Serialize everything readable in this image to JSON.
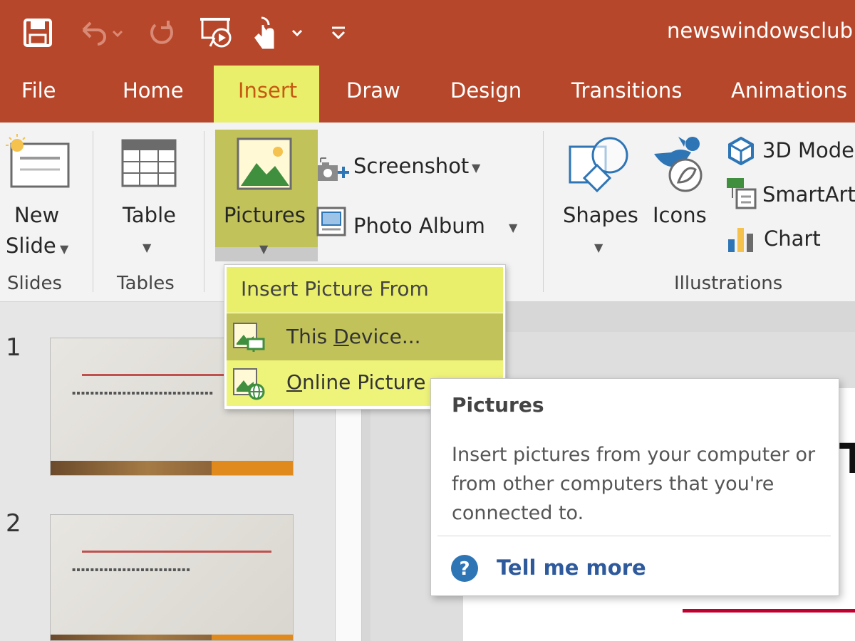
{
  "window": {
    "document_title": "newswindowsclub",
    "accent_color": "#b7472a",
    "highlight_color": "#e9ee6b"
  },
  "quick_access": [
    {
      "icon": "save-icon"
    },
    {
      "icon": "undo-icon"
    },
    {
      "icon": "redo-icon"
    },
    {
      "icon": "present-from-beginning-icon"
    },
    {
      "icon": "touch-mode-icon"
    },
    {
      "icon": "customize-toolbar-icon"
    }
  ],
  "tabs": {
    "file": "File",
    "home": "Home",
    "insert": "Insert",
    "draw": "Draw",
    "design": "Design",
    "transitions": "Transitions",
    "animations": "Animations"
  },
  "ribbon": {
    "new_slide_line1": "New",
    "new_slide_line2": "Slide",
    "table": "Table",
    "pictures": "Pictures",
    "screenshot": "Screenshot",
    "photo_album": "Photo Album",
    "shapes": "Shapes",
    "icons": "Icons",
    "models_3d": "3D Mode",
    "smartart": "SmartArt",
    "chart": "Chart",
    "groups": {
      "slides": "Slides",
      "tables": "Tables",
      "illustrations": "Illustrations"
    }
  },
  "dropdown": {
    "header": "Insert Picture From",
    "this_device_prefix": "This ",
    "this_device_accel": "D",
    "this_device_rest": "evice...",
    "online_accel": "O",
    "online_rest": "nline Picture"
  },
  "tooltip": {
    "title": "Pictures",
    "body": "Insert pictures from your computer or from other computers that you're connected to.",
    "link": "Tell me more"
  },
  "slides": [
    {
      "number": "1"
    },
    {
      "number": "2"
    }
  ]
}
